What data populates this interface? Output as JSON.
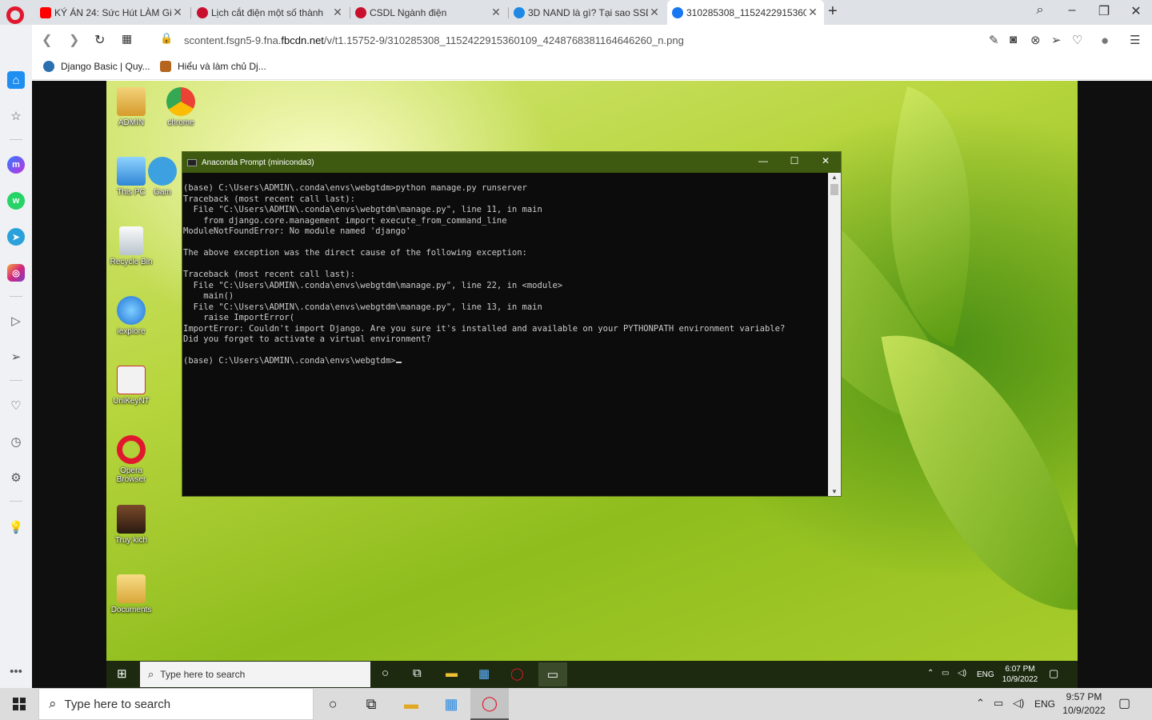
{
  "browser": {
    "tabs": [
      {
        "title": "KÝ ÁN 24: Sức Hút LÀM Gi",
        "favicon_color": "#ff0000"
      },
      {
        "title": "Lịch cắt điện một số thành",
        "favicon_color": "#c8102e"
      },
      {
        "title": "CSDL Ngành điện",
        "favicon_color": "#c8102e"
      },
      {
        "title": "3D NAND là gì? Tại sao SSD",
        "favicon_color": "#1e88e5"
      },
      {
        "title": "310285308_1152422915360",
        "favicon_color": "#1877f2",
        "active": true
      }
    ],
    "url_prefix": "scontent.fsgn5-9.fna.",
    "url_domain": "fbcdn.net",
    "url_suffix": "/v/t1.15752-9/310285308_1152422915360109_4248768381164646260_n.png",
    "bookmarks": [
      {
        "label": "Django Basic | Quy...",
        "icon_color": "#2a6fb0"
      },
      {
        "label": "Hiểu và làm chủ Dj...",
        "icon_color": "#b5651d"
      }
    ]
  },
  "desktop": {
    "icons": [
      {
        "label": "ADMIN",
        "color": "#e8b84a"
      },
      {
        "label": "chrome",
        "color": "#e34133"
      },
      {
        "label": "This PC",
        "color": "#4aa3df"
      },
      {
        "label": "Recycle Bin",
        "color": "#dfe8ef"
      },
      {
        "label": "iexplore",
        "color": "#1e90ff"
      },
      {
        "label": "UniKeyNT",
        "color": "#e8e8e8"
      },
      {
        "label": "Opera Browser",
        "color": "#e0182d"
      },
      {
        "label": "Truy kich",
        "color": "#7a4a2a"
      },
      {
        "label": "Documents",
        "color": "#e8c05a"
      },
      {
        "label": "Gam",
        "color": "#3da0e0"
      }
    ]
  },
  "console": {
    "title": "Anaconda Prompt (miniconda3)",
    "output": "(base) C:\\Users\\ADMIN\\.conda\\envs\\webgtdm>python manage.py runserver\nTraceback (most recent call last):\n  File \"C:\\Users\\ADMIN\\.conda\\envs\\webgtdm\\manage.py\", line 11, in main\n    from django.core.management import execute_from_command_line\nModuleNotFoundError: No module named 'django'\n\nThe above exception was the direct cause of the following exception:\n\nTraceback (most recent call last):\n  File \"C:\\Users\\ADMIN\\.conda\\envs\\webgtdm\\manage.py\", line 22, in <module>\n    main()\n  File \"C:\\Users\\ADMIN\\.conda\\envs\\webgtdm\\manage.py\", line 13, in main\n    raise ImportError(\nImportError: Couldn't import Django. Are you sure it's installed and available on your PYTHONPATH environment variable?\nDid you forget to activate a virtual environment?\n\n(base) C:\\Users\\ADMIN\\.conda\\envs\\webgtdm>"
  },
  "inner_taskbar": {
    "search_placeholder": "Type here to search",
    "lang": "ENG",
    "time": "6:07 PM",
    "date": "10/9/2022"
  },
  "taskbar": {
    "search_placeholder": "Type here to search",
    "lang": "ENG",
    "time": "9:57 PM",
    "date": "10/9/2022"
  }
}
